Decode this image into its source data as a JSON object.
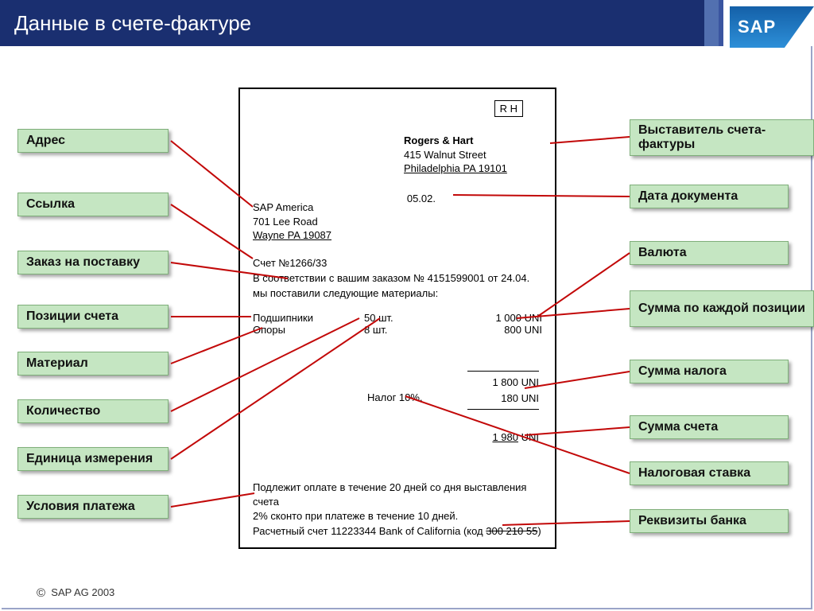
{
  "header": {
    "title": "Данные в счете-фактуре",
    "logo": "SAP"
  },
  "left_labels": {
    "address": "Адрес",
    "reference": "Ссылка",
    "purchase_order": "Заказ на поставку",
    "invoice_items": "Позиции счета",
    "material": "Материал",
    "quantity": "Количество",
    "uom": "Единица измерения",
    "payment_terms": "Условия платежа"
  },
  "right_labels": {
    "issuer": "Выставитель счета-фактуры",
    "doc_date": "Дата документа",
    "currency": "Валюта",
    "per_item_amount": "Сумма по каждой позиции",
    "tax_amount": "Сумма налога",
    "invoice_amount": "Сумма счета",
    "tax_rate": "Налоговая ставка",
    "bank_details": "Реквизиты банка"
  },
  "invoice": {
    "rh": "R H",
    "vendor": {
      "name": "Rogers & Hart",
      "street": "415 Walnut Street",
      "city": "Philadelphia PA 19101"
    },
    "date": "05.02.",
    "ship_to": {
      "name": "SAP America",
      "street": "701 Lee Road",
      "city": "Wayne PA 19087"
    },
    "ref_line": "Счет №1266/33",
    "po_line": "В соответствии с вашим заказом № 4151599001 от 24.04. мы поставили следующие материалы:",
    "items": [
      {
        "material": "Подшипники",
        "qty": "50 шт.",
        "amount": "1 000 UNI"
      },
      {
        "material": "Опоры",
        "qty": "8 шт.",
        "amount": "800 UNI"
      }
    ],
    "subtotal": "1 800 UNI",
    "tax_value": "180 UNI",
    "tax_label": "Налог 10%.",
    "grand_total": "1 980",
    "grand_currency": "UNI",
    "terms_line1": "Подлежит оплате в течение 20 дней со дня выставления счета",
    "terms_line2": "2% сконто при платеже в течение 10 дней.",
    "bank_line_prefix": "Расчетный счет 11223344 Bank of California (код ",
    "bank_code": "300 210 55",
    "bank_line_suffix": ")"
  },
  "footer": {
    "copyright": "SAP AG 2003"
  }
}
